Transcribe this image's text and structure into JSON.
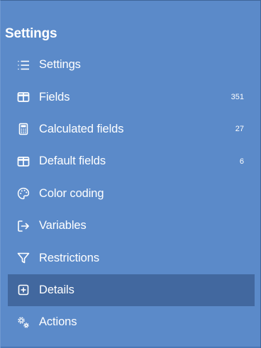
{
  "title": "Settings",
  "menu": {
    "items": [
      {
        "label": "Settings",
        "icon": "list-icon",
        "count": ""
      },
      {
        "label": "Fields",
        "icon": "table-icon",
        "count": "351"
      },
      {
        "label": "Calculated fields",
        "icon": "calculator-icon",
        "count": "27"
      },
      {
        "label": "Default fields",
        "icon": "table-icon",
        "count": "6"
      },
      {
        "label": "Color coding",
        "icon": "palette-icon",
        "count": ""
      },
      {
        "label": "Variables",
        "icon": "arrow-right-icon",
        "count": ""
      },
      {
        "label": "Restrictions",
        "icon": "filter-icon",
        "count": ""
      },
      {
        "label": "Details",
        "icon": "plus-square-icon",
        "count": ""
      },
      {
        "label": "Actions",
        "icon": "gears-icon",
        "count": ""
      }
    ],
    "active_item": "Details"
  },
  "colors": {
    "background": "#5b8ac9",
    "active_background": "#42689f",
    "text": "#ffffff"
  }
}
